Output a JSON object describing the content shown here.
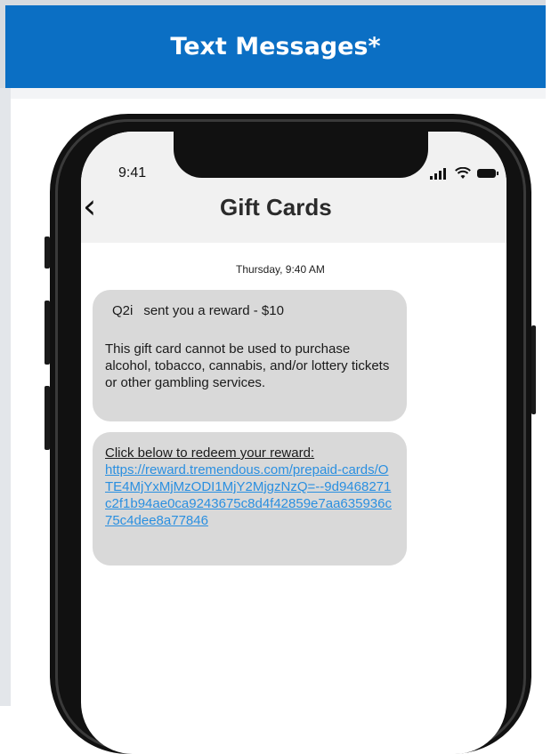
{
  "header": {
    "title": "Text Messages*"
  },
  "status_bar": {
    "time": "9:41",
    "icons": [
      "signal-icon",
      "wifi-icon",
      "battery-icon"
    ]
  },
  "nav": {
    "back_icon": "chevron-left-icon",
    "title": "Gift Cards"
  },
  "conversation": {
    "timestamp": "Thursday, 9:40 AM",
    "messages": [
      {
        "sender": "Q2i",
        "line1": "sent you a reward - $10",
        "body": "This gift card cannot be used to purchase alcohol, tobacco, cannabis, and/or lottery tickets or other gambling services."
      },
      {
        "prompt": "Click below to redeem your reward:",
        "link": "https://reward.tremendous.com/prepaid-cards/OTE4MjYxMjMzODI1MjY2MjgzNzQ=--9d9468271c2f1b94ae0ca9243675c8d4f42859e7aa635936c75c4dee8a77846"
      }
    ]
  },
  "colors": {
    "header_bg": "#0b6fc4",
    "bubble_bg": "#d9d9d9",
    "link": "#2a8fe0"
  }
}
